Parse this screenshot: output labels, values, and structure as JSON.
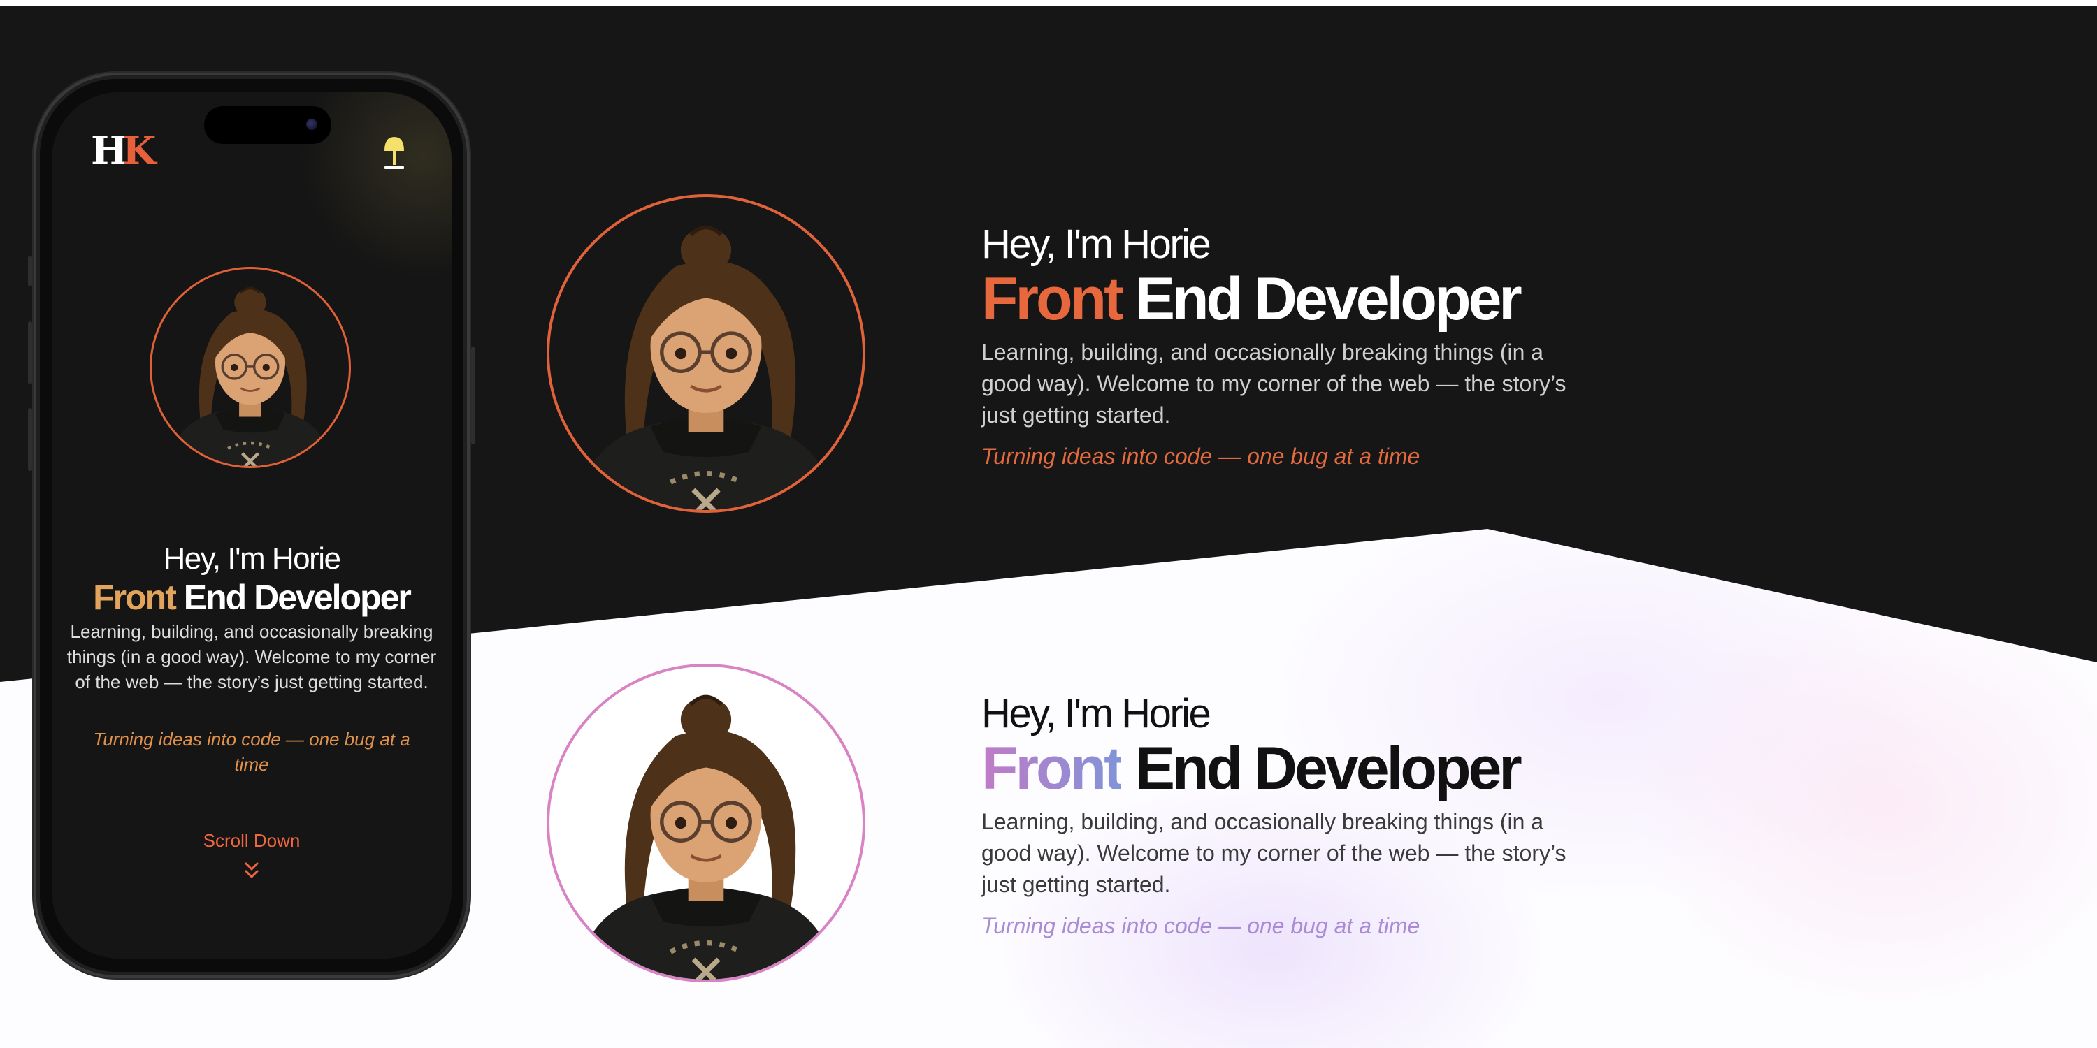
{
  "hero": {
    "greeting": "Hey, I'm Horie",
    "role_accent": "Front",
    "role_rest": "End Developer",
    "description": "Learning, building, and occasionally breaking things (in a good way). Welcome to my corner of the web — the story’s just getting started.",
    "tagline": "Turning ideas into code — one bug at a time"
  },
  "mobile": {
    "logo": "HK",
    "theme_toggle_icon": "lamp-icon",
    "scroll_label": "Scroll Down",
    "scroll_icon": "double-chevron-down-icon"
  },
  "colors": {
    "dark_background": "#161616",
    "dark_accent": "#e8683d",
    "mobile_accent": "#e2a45c",
    "light_accent_start": "#c07bc6",
    "light_accent_end": "#8094d8",
    "light_border": "#d884c4"
  }
}
